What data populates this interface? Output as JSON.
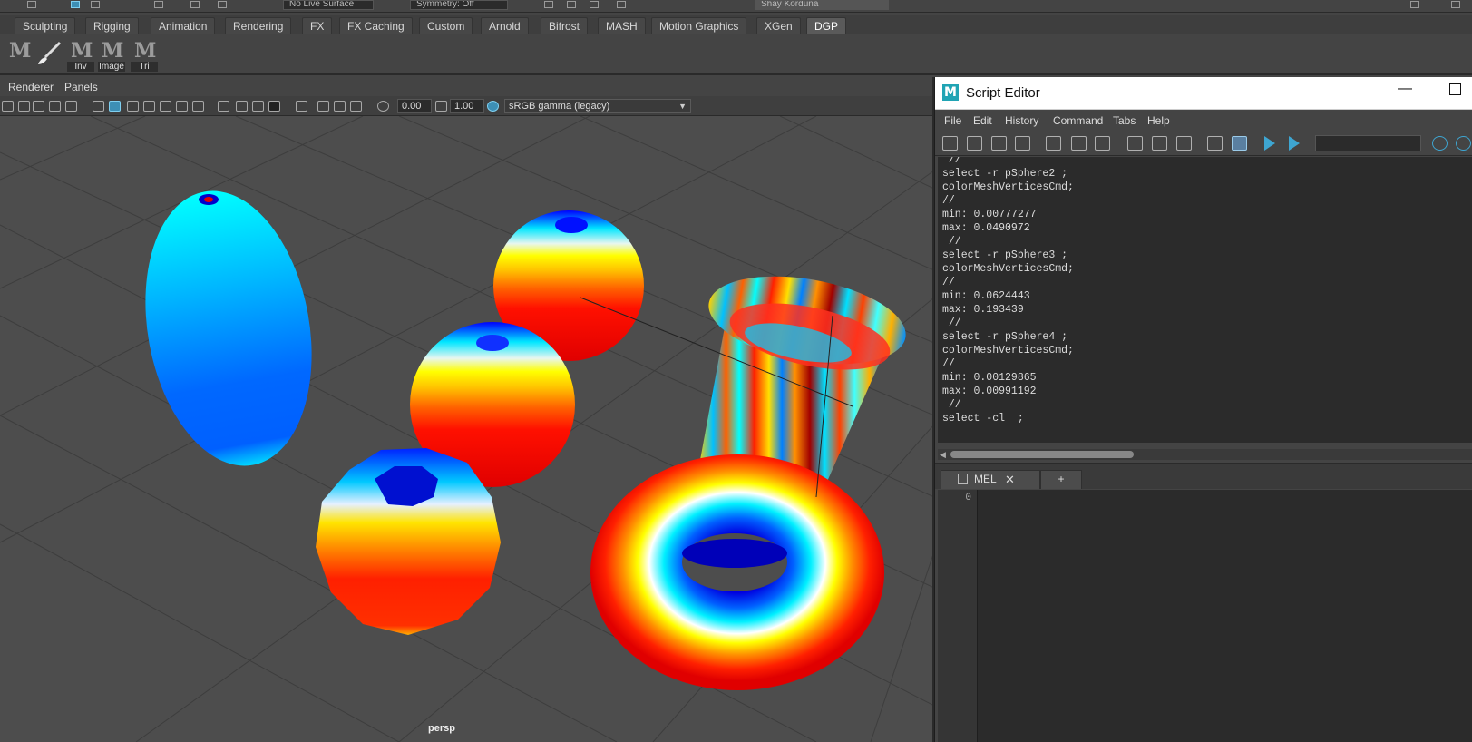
{
  "topline": {
    "field1": "No Live Surface",
    "field2": "Symmetry: Off",
    "user": "Shay Korduna"
  },
  "shelf_tabs": [
    "Sculpting",
    "Rigging",
    "Animation",
    "Rendering",
    "FX",
    "FX Caching",
    "Custom",
    "Arnold",
    "Bifrost",
    "MASH",
    "Motion Graphics",
    "XGen",
    "DGP"
  ],
  "shelf_buttons": {
    "b3": "Inv",
    "b4": "Image",
    "b5": "Tri"
  },
  "viewport": {
    "menu": {
      "renderer": "Renderer",
      "panels": "Panels"
    },
    "exposure": "0.00",
    "gamma": "1.00",
    "colorspace": "sRGB gamma (legacy)",
    "camera_label": "persp"
  },
  "script_editor": {
    "title": "Script Editor",
    "logo": "M",
    "menu": {
      "file": "File",
      "edit": "Edit",
      "history": "History",
      "command": "Command",
      "tabs": "Tabs",
      "help": "Help"
    },
    "history_text": " //\nselect -r pSphere2 ;\ncolorMeshVerticesCmd;\n//\nmin: 0.00777277\nmax: 0.0490972\n //\nselect -r pSphere3 ;\ncolorMeshVerticesCmd;\n//\nmin: 0.0624443\nmax: 0.193439\n //\nselect -r pSphere4 ;\ncolorMeshVerticesCmd;\n//\nmin: 0.00129865\nmax: 0.00991192\n //\nselect -cl  ;",
    "tab_label": "MEL",
    "add_tab": "+",
    "line_number": "0"
  },
  "colors": {
    "accent": "#3ea6d2",
    "viewport_bg": "#4d4d4d",
    "grid": "#3a3a3a"
  }
}
